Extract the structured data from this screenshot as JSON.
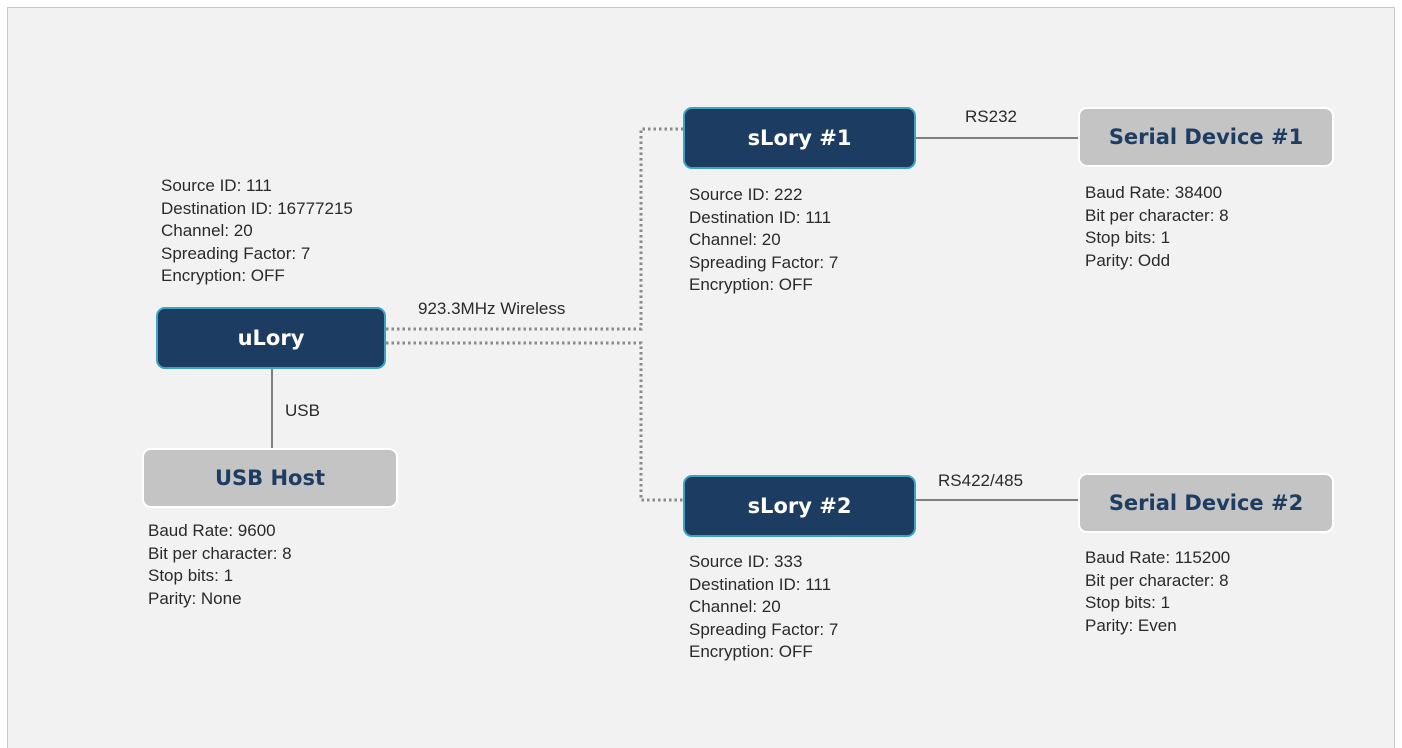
{
  "nodes": {
    "ulory": "uLory",
    "usb_host": "USB Host",
    "slory1": "sLory #1",
    "slory2": "sLory #2",
    "serial1": "Serial Device #1",
    "serial2": "Serial Device #2"
  },
  "links": {
    "usb": "USB",
    "wireless": "923.3MHz Wireless",
    "rs232": "RS232",
    "rs422": "RS422/485"
  },
  "info": {
    "ulory": [
      "Source ID: 111",
      "Destination ID: 16777215",
      "Channel: 20",
      "Spreading Factor: 7",
      "Encryption: OFF"
    ],
    "usb_host": [
      "Baud Rate: 9600",
      "Bit per character: 8",
      "Stop bits: 1",
      "Parity: None"
    ],
    "slory1": [
      "Source ID: 222",
      "Destination ID: 111",
      "Channel: 20",
      "Spreading Factor: 7",
      "Encryption: OFF"
    ],
    "slory2": [
      "Source ID: 333",
      "Destination ID: 111",
      "Channel: 20",
      "Spreading Factor: 7",
      "Encryption: OFF"
    ],
    "serial1": [
      "Baud Rate: 38400",
      "Bit per character: 8",
      "Stop bits: 1",
      "Parity: Odd"
    ],
    "serial2": [
      "Baud Rate: 115200",
      "Bit per character: 8",
      "Stop bits: 1",
      "Parity: Even"
    ]
  },
  "colors": {
    "node_dark": "#1d3c62",
    "node_border": "#3ea3c2",
    "node_light": "#c4c4c4",
    "line": "#7f7f7f"
  }
}
